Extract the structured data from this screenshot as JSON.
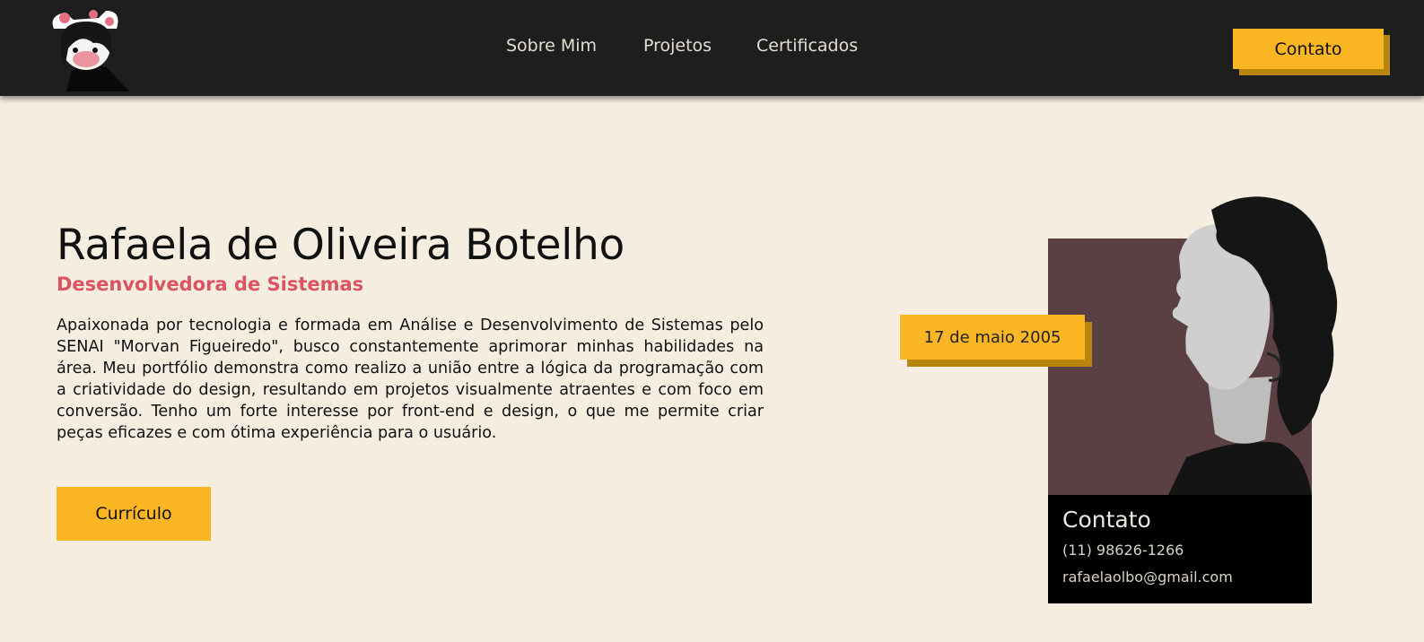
{
  "nav": {
    "links": [
      "Sobre Mim",
      "Projetos",
      "Certificados"
    ],
    "contact_button": "Contato"
  },
  "hero": {
    "name": "Rafaela de Oliveira Botelho",
    "role": "Desenvolvedora de Sistemas",
    "bio": "Apaixonada por tecnologia e formada em Análise e Desenvolvimento de Sistemas pelo SENAI \"Morvan Figueiredo\", busco constantemente aprimorar minhas habilidades na área. Meu portfólio demonstra como realizo a união entre a lógica da programação com a criatividade do design, resultando em projetos visualmente atraentes e com foco em conversão. Tenho um forte interesse por front-end e design, o que me permite criar peças eficazes e com ótima experiência para o usuário.",
    "cv_button": "Currículo"
  },
  "profile": {
    "birth_date": "17 de maio 2005",
    "contact_title": "Contato",
    "phone": "(11) 98626-1266",
    "email": "rafaelaolbo@gmail.com"
  },
  "colors": {
    "nav_bg": "#1e1e1e",
    "page_bg": "#f5ede0",
    "accent_yellow": "#fbb624",
    "accent_shadow": "#b8860f",
    "role_pink": "#dc5462",
    "photo_bg": "#5b4043"
  },
  "icons": {
    "logo": "cartoon-avatar-logo-icon",
    "portrait": "profile-portrait-photo"
  }
}
